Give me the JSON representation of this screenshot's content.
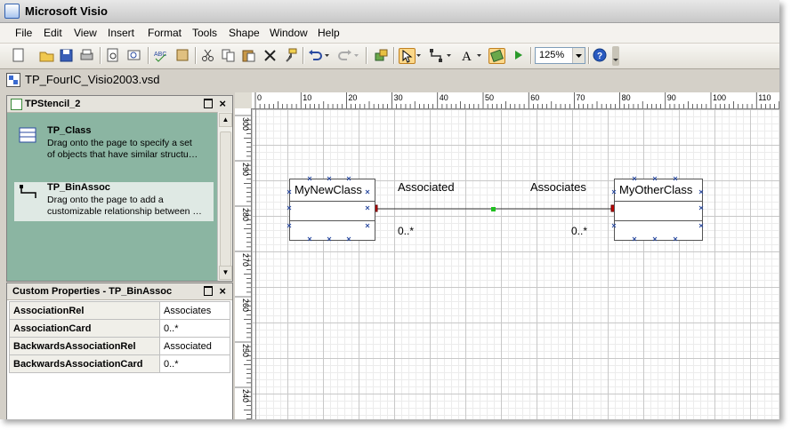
{
  "app": {
    "title": "Microsoft Visio"
  },
  "menu": [
    "File",
    "Edit",
    "View",
    "Insert",
    "Format",
    "Tools",
    "Shape",
    "Window",
    "Help"
  ],
  "toolbar": {
    "zoom": "125%",
    "icons": [
      "new-icon",
      "open-icon",
      "save-icon",
      "print-icon",
      "print-preview-icon",
      "spelling-icon",
      "research-icon",
      "cut-icon",
      "copy-icon",
      "paste-icon",
      "delete-icon",
      "format-painter-icon",
      "undo-icon",
      "redo-icon",
      "shapes-icon",
      "pointer-icon",
      "connector-icon",
      "text-icon",
      "connection-point-icon",
      "run-icon",
      "help-icon"
    ]
  },
  "document": {
    "name": "TP_FourIC_Visio2003.vsd"
  },
  "stencil": {
    "title": "TPStencil_2",
    "items": [
      {
        "name": "TP_Class",
        "desc1": "Drag onto the page to specify a set",
        "desc2": "of objects that have similar structu…"
      },
      {
        "name": "TP_BinAssoc",
        "desc1": "Drag onto the page to add a",
        "desc2": "customizable relationship between …"
      }
    ]
  },
  "properties": {
    "title": "Custom Properties - TP_BinAssoc",
    "rows": [
      {
        "key": "AssociationRel",
        "value": "Associates"
      },
      {
        "key": "AssociationCard",
        "value": "0..*"
      },
      {
        "key": "BackwardsAssociationRel",
        "value": "Associated"
      },
      {
        "key": "BackwardsAssociationCard",
        "value": "0..*"
      }
    ]
  },
  "ruler": {
    "h": [
      "0",
      "10",
      "20",
      "30",
      "40",
      "50",
      "60",
      "70",
      "80",
      "90",
      "100",
      "110"
    ],
    "v": [
      "300",
      "290",
      "280",
      "270",
      "260",
      "250",
      "240"
    ]
  },
  "diagram": {
    "class1": "MyNewClass",
    "class2": "MyOtherClass",
    "assoc_left": "Associated",
    "assoc_right": "Associates",
    "card_left": "0..*",
    "card_right": "0..*"
  }
}
